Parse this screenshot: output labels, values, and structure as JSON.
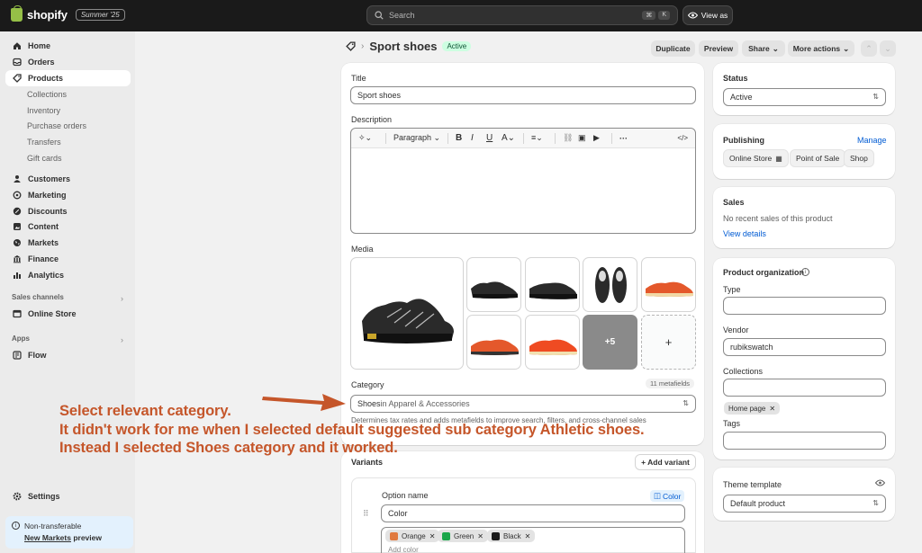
{
  "topbar": {
    "brand": "shopify",
    "edition": "Summer '25",
    "search_placeholder": "Search",
    "kbd1": "⌘",
    "kbd2": "K",
    "view_as": "View as"
  },
  "sidebar": {
    "items": [
      {
        "label": "Home",
        "icon": "home-icon"
      },
      {
        "label": "Orders",
        "icon": "inbox-icon"
      },
      {
        "label": "Products",
        "icon": "tag-icon"
      },
      {
        "label": "Collections"
      },
      {
        "label": "Inventory"
      },
      {
        "label": "Purchase orders"
      },
      {
        "label": "Transfers"
      },
      {
        "label": "Gift cards"
      },
      {
        "label": "Customers",
        "icon": "person-icon"
      },
      {
        "label": "Marketing",
        "icon": "target-icon"
      },
      {
        "label": "Discounts",
        "icon": "discount-icon"
      },
      {
        "label": "Content",
        "icon": "content-icon"
      },
      {
        "label": "Markets",
        "icon": "globe-icon"
      },
      {
        "label": "Finance",
        "icon": "bank-icon"
      },
      {
        "label": "Analytics",
        "icon": "chart-icon"
      },
      {
        "label": "Online Store",
        "icon": "store-icon"
      },
      {
        "label": "Flow",
        "icon": "flow-icon"
      },
      {
        "label": "Settings",
        "icon": "gear-icon"
      }
    ],
    "sales_channels": "Sales channels",
    "apps": "Apps",
    "promo_line1": "Non-transferable",
    "promo_link": "New Markets",
    "promo_tail": " preview"
  },
  "header": {
    "title": "Sport shoes",
    "status_badge": "Active",
    "duplicate": "Duplicate",
    "preview": "Preview",
    "share": "Share",
    "more_actions": "More actions"
  },
  "main": {
    "title_label": "Title",
    "title_value": "Sport shoes",
    "description_label": "Description",
    "rte_paragraph": "Paragraph",
    "media_label": "Media",
    "media_more": "+5",
    "media_add": "+",
    "category_label": "Category",
    "metafields_badge": "11 metafields",
    "category_value": "Shoes",
    "category_path": " in Apparel & Accessories",
    "category_hint": "Determines tax rates and adds metafields to improve search, filters, and cross-channel sales",
    "variants_label": "Variants",
    "add_variant": "+ Add variant",
    "option_name_label": "Option name",
    "color_badge": "Color",
    "option_name_value": "Color",
    "option_values": [
      {
        "label": "Orange",
        "color": "#e0793f"
      },
      {
        "label": "Green",
        "color": "#1aa64a"
      },
      {
        "label": "Black",
        "color": "#1a1a1a"
      }
    ],
    "add_color_placeholder": "Add color"
  },
  "right": {
    "status_label": "Status",
    "status_value": "Active",
    "publishing_label": "Publishing",
    "manage": "Manage",
    "channels": [
      "Online Store",
      "Point of Sale",
      "Shop"
    ],
    "sales_label": "Sales",
    "sales_text": "No recent sales of this product",
    "view_details": "View details",
    "org_label": "Product organization",
    "type_label": "Type",
    "type_value": "",
    "vendor_label": "Vendor",
    "vendor_value": "rubikswatch",
    "collections_label": "Collections",
    "collection_tag": "Home page",
    "tags_label": "Tags",
    "theme_label": "Theme template",
    "theme_value": "Default product"
  },
  "annotation": {
    "line1": "Select relevant category.",
    "line2": "It didn't work for me when I selected default suggested sub category Athletic shoes.",
    "line3": "Instead I selected Shoes category and it worked."
  },
  "colors": {
    "annotation": "#c5562a",
    "accent_link": "#005bd3",
    "active_badge_bg": "#cdfee1",
    "topbar": "#1a1a1a"
  }
}
